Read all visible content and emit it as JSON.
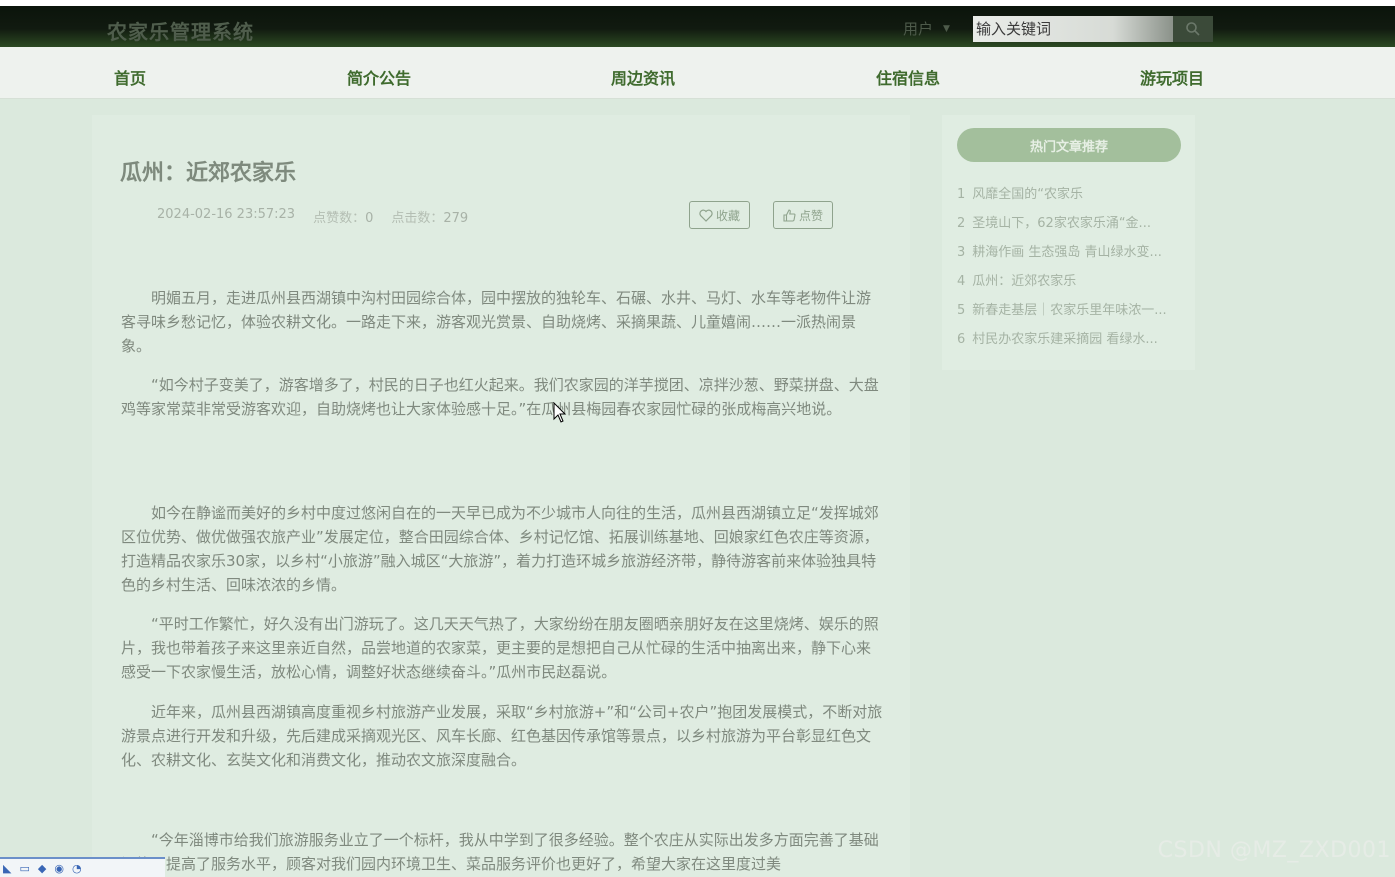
{
  "header": {
    "brand": "农家乐管理系统",
    "user_menu": "用户",
    "search_placeholder": "输入关键词"
  },
  "nav": [
    "首页",
    "简介公告",
    "周边资讯",
    "住宿信息",
    "游玩项目"
  ],
  "article": {
    "title": "瓜州：近郊农家乐",
    "date": "2024-02-16 23:57:23",
    "likes_label": "点赞数：",
    "likes": "0",
    "clicks_label": "点击数：",
    "clicks": "279",
    "favorite_label": "收藏",
    "like_label": "点赞",
    "paragraphs": [
      "明媚五月，走进瓜州县西湖镇中沟村田园综合体，园中摆放的独轮车、石碾、水井、马灯、水车等老物件让游客寻味乡愁记忆，体验农耕文化。一路走下来，游客观光赏景、自助烧烤、采摘果蔬、儿童嬉闹……一派热闹景象。",
      "“如今村子变美了，游客增多了，村民的日子也红火起来。我们农家园的洋芋搅团、凉拌沙葱、野菜拼盘、大盘鸡等家常菜非常受游客欢迎，自助烧烤也让大家体验感十足。”在瓜州县梅园春农家园忙碌的张成梅高兴地说。",
      "如今在静谧而美好的乡村中度过悠闲自在的一天早已成为不少城市人向往的生活，瓜州县西湖镇立足“发挥城郊区位优势、做优做强农旅产业”发展定位，整合田园综合体、乡村记忆馆、拓展训练基地、回娘家红色农庄等资源，打造精品农家乐30家，以乡村“小旅游”融入城区“大旅游”，着力打造环城乡旅游经济带，静待游客前来体验独具特色的乡村生活、回味浓浓的乡情。",
      "“平时工作繁忙，好久没有出门游玩了。这几天天气热了，大家纷纷在朋友圈晒亲朋好友在这里烧烤、娱乐的照片，我也带着孩子来这里亲近自然，品尝地道的农家菜，更主要的是想把自己从忙碌的生活中抽离出来，静下心来感受一下农家慢生活，放松心情，调整好状态继续奋斗。”瓜州市民赵磊说。",
      "近年来，瓜州县西湖镇高度重视乡村旅游产业发展，采取“乡村旅游+”和“公司+农户”抱团发展模式，不断对旅游景点进行开发和升级，先后建成采摘观光区、风车长廊、红色基因传承馆等景点，以乡村旅游为平台彰显红色文化、农耕文化、玄奘文化和消费文化，推动农文旅深度融合。",
      "“今年淄博市给我们旅游服务业立了一个标杆，我从中学到了很多经验。整个农庄从实际出发多方面完善了基础设施，提高了服务水平，顾客对我们园内环境卫生、菜品服务评价也更好了，希望大家在这里度过美"
    ]
  },
  "sidebar": {
    "heading": "热门文章推荐",
    "items": [
      {
        "num": "1",
        "text": "风靡全国的“农家乐"
      },
      {
        "num": "2",
        "text": "圣境山下，62家农家乐涌“金..."
      },
      {
        "num": "3",
        "text": "耕海作画 生态强岛 青山绿水变..."
      },
      {
        "num": "4",
        "text": "瓜州：近郊农家乐"
      },
      {
        "num": "5",
        "text": "新春走基层｜农家乐里年味浓一..."
      },
      {
        "num": "6",
        "text": "村民办农家乐建采摘园 看绿水..."
      }
    ]
  },
  "watermark": "CSDN @MZ_ZXD001"
}
